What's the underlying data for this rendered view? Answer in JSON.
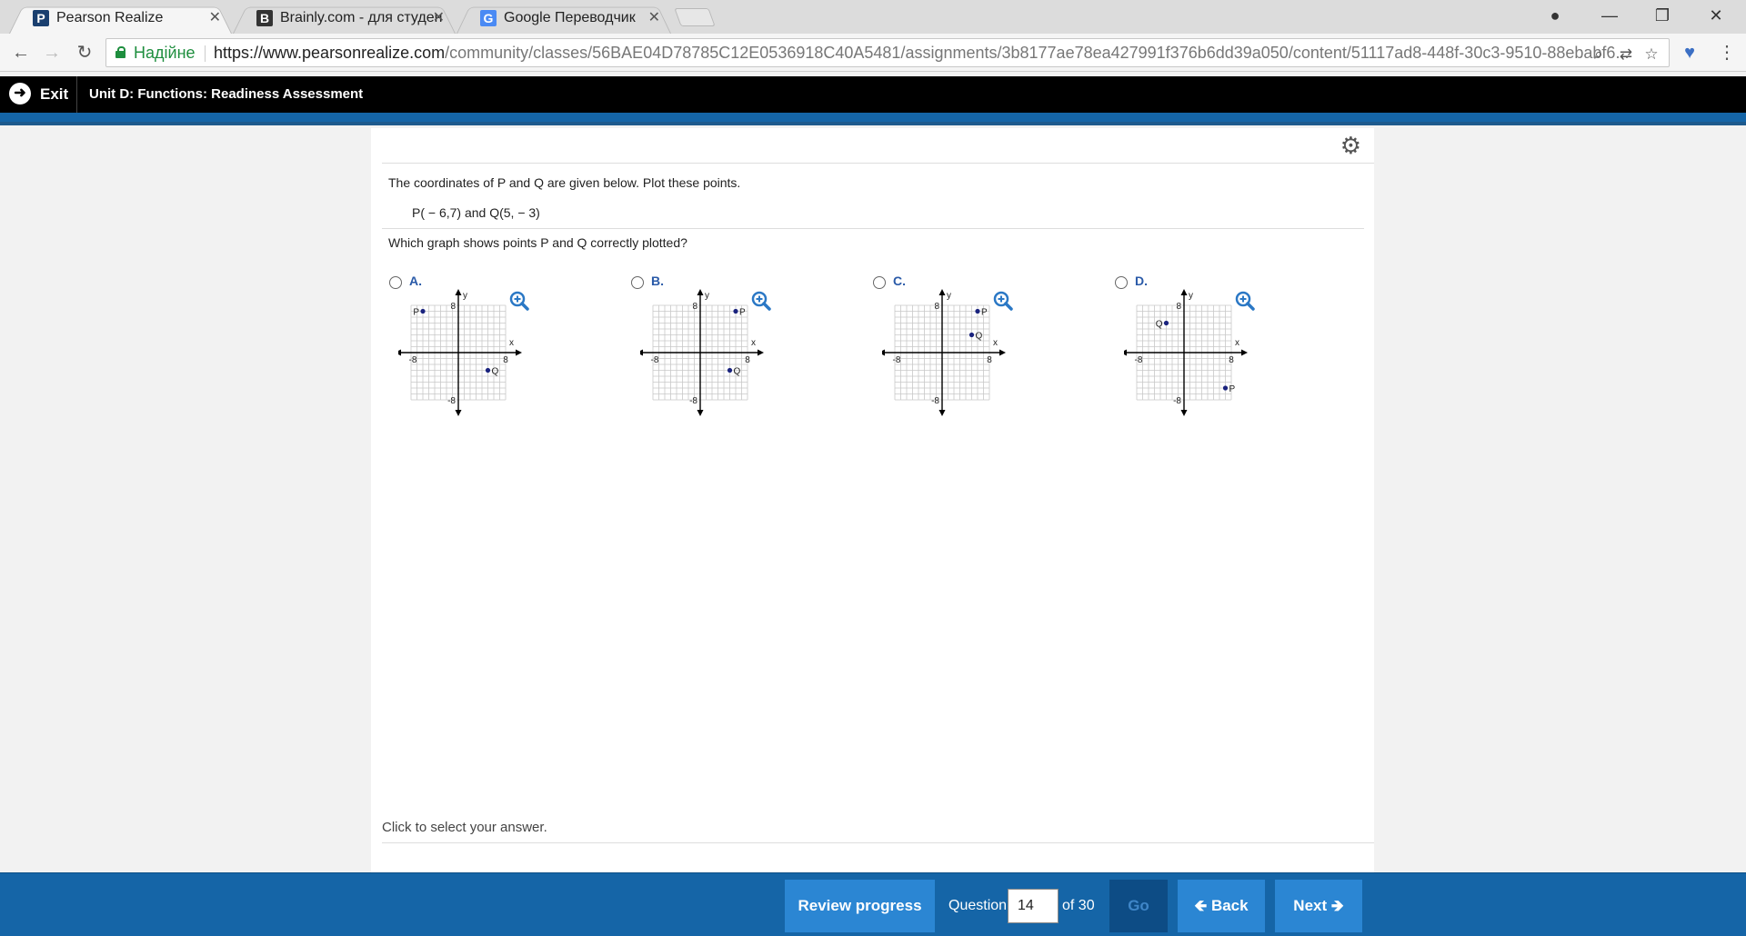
{
  "browser": {
    "tabs": [
      {
        "title": "Pearson Realize",
        "icon": "pearson-p-icon",
        "active": true
      },
      {
        "title": "Brainly.com - для студен",
        "icon": "brainly-b-icon",
        "active": false
      },
      {
        "title": "Google Переводчик",
        "icon": "google-translate-icon",
        "active": false
      }
    ],
    "secure_label": "Надійне",
    "url_host": "https://www.pearsonrealize.com",
    "url_path": "/community/classes/56BAE04D78785C12E0536918C40A5481/assignments/3b8177ae78ea427991f376b6dd39a050/content/51117ad8-448f-30c3-9510-88ebabf6..."
  },
  "header": {
    "exit_label": "Exit",
    "unit_title": "Unit D: Functions: Readiness Assessment"
  },
  "question": {
    "prompt": "The coordinates of P and Q are given below. Plot these points.",
    "coords": "P( − 6,7) and Q(5, − 3)",
    "ask": "Which graph shows points P and Q correctly plotted?",
    "footnote": "Click to select your answer."
  },
  "graph_axes": {
    "x_label": "x",
    "y_label": "y",
    "min_label": "-8",
    "max_label": "8",
    "range": [
      -8,
      8
    ]
  },
  "chart_data": [
    {
      "type": "scatter",
      "choice": "A.",
      "points": [
        {
          "label": "P",
          "x": -6,
          "y": 7
        },
        {
          "label": "Q",
          "x": 5,
          "y": -3
        }
      ],
      "xlim": [
        -8,
        8
      ],
      "ylim": [
        -8,
        8
      ]
    },
    {
      "type": "scatter",
      "choice": "B.",
      "points": [
        {
          "label": "P",
          "x": 6,
          "y": 7
        },
        {
          "label": "Q",
          "x": 5,
          "y": -3
        }
      ],
      "xlim": [
        -8,
        8
      ],
      "ylim": [
        -8,
        8
      ]
    },
    {
      "type": "scatter",
      "choice": "C.",
      "points": [
        {
          "label": "P",
          "x": 6,
          "y": 7
        },
        {
          "label": "Q",
          "x": 5,
          "y": 3
        }
      ],
      "xlim": [
        -8,
        8
      ],
      "ylim": [
        -8,
        8
      ]
    },
    {
      "type": "scatter",
      "choice": "D.",
      "points": [
        {
          "label": "Q",
          "x": -3,
          "y": 5
        },
        {
          "label": "P",
          "x": 7,
          "y": -6
        }
      ],
      "xlim": [
        -8,
        8
      ],
      "ylim": [
        -8,
        8
      ]
    }
  ],
  "footer": {
    "review_label": "Review progress",
    "question_label": "Question",
    "question_number": "14",
    "of_label": "of 30",
    "go_label": "Go",
    "back_label": "Back",
    "next_label": "Next"
  },
  "colors": {
    "header_bg": "#000000",
    "accent_blue": "#1565a7",
    "button_blue": "#2b86d3",
    "point_color": "#1a237e"
  }
}
